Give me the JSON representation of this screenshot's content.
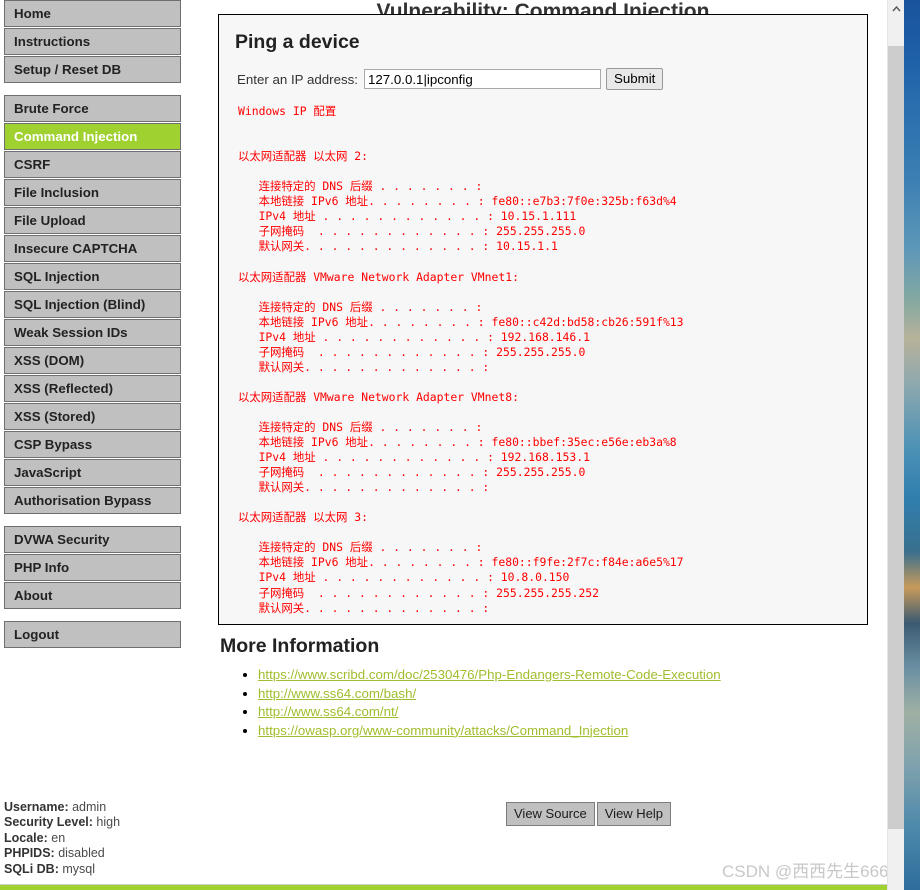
{
  "page": {
    "title": "Vulnerability: Command Injection",
    "bottom_rule_color": "#9fd130",
    "accent_color": "#9fd130"
  },
  "sidebar": {
    "groups": [
      {
        "name": "primary",
        "items": [
          {
            "label": "Home",
            "active": false
          },
          {
            "label": "Instructions",
            "active": false
          },
          {
            "label": "Setup / Reset DB",
            "active": false
          }
        ]
      },
      {
        "name": "vulnerabilities",
        "items": [
          {
            "label": "Brute Force",
            "active": false
          },
          {
            "label": "Command Injection",
            "active": true
          },
          {
            "label": "CSRF",
            "active": false
          },
          {
            "label": "File Inclusion",
            "active": false
          },
          {
            "label": "File Upload",
            "active": false
          },
          {
            "label": "Insecure CAPTCHA",
            "active": false
          },
          {
            "label": "SQL Injection",
            "active": false
          },
          {
            "label": "SQL Injection (Blind)",
            "active": false
          },
          {
            "label": "Weak Session IDs",
            "active": false
          },
          {
            "label": "XSS (DOM)",
            "active": false
          },
          {
            "label": "XSS (Reflected)",
            "active": false
          },
          {
            "label": "XSS (Stored)",
            "active": false
          },
          {
            "label": "CSP Bypass",
            "active": false
          },
          {
            "label": "JavaScript",
            "active": false
          },
          {
            "label": "Authorisation Bypass",
            "active": false
          }
        ]
      },
      {
        "name": "meta",
        "items": [
          {
            "label": "DVWA Security",
            "active": false
          },
          {
            "label": "PHP Info",
            "active": false
          },
          {
            "label": "About",
            "active": false
          }
        ]
      },
      {
        "name": "session",
        "items": [
          {
            "label": "Logout",
            "active": false
          }
        ]
      }
    ]
  },
  "main": {
    "heading": "Ping a device",
    "form": {
      "label": "Enter an IP address:",
      "input_value": "127.0.0.1|ipconfig",
      "input_placeholder": "",
      "submit_label": "Submit"
    },
    "command_output": "Windows IP 配置\n\n\n以太网适配器 以太网 2:\n\n   连接特定的 DNS 后缀 . . . . . . . :\n   本地链接 IPv6 地址. . . . . . . . : fe80::e7b3:7f0e:325b:f63d%4\n   IPv4 地址 . . . . . . . . . . . . : 10.15.1.111\n   子网掩码  . . . . . . . . . . . . : 255.255.255.0\n   默认网关. . . . . . . . . . . . . : 10.15.1.1\n\n以太网适配器 VMware Network Adapter VMnet1:\n\n   连接特定的 DNS 后缀 . . . . . . . :\n   本地链接 IPv6 地址. . . . . . . . : fe80::c42d:bd58:cb26:591f%13\n   IPv4 地址 . . . . . . . . . . . . : 192.168.146.1\n   子网掩码  . . . . . . . . . . . . : 255.255.255.0\n   默认网关. . . . . . . . . . . . . :\n\n以太网适配器 VMware Network Adapter VMnet8:\n\n   连接特定的 DNS 后缀 . . . . . . . :\n   本地链接 IPv6 地址. . . . . . . . : fe80::bbef:35ec:e56e:eb3a%8\n   IPv4 地址 . . . . . . . . . . . . : 192.168.153.1\n   子网掩码  . . . . . . . . . . . . : 255.255.255.0\n   默认网关. . . . . . . . . . . . . :\n\n以太网适配器 以太网 3:\n\n   连接特定的 DNS 后缀 . . . . . . . :\n   本地链接 IPv6 地址. . . . . . . . : fe80::f9fe:2f7c:f84e:a6e5%17\n   IPv4 地址 . . . . . . . . . . . . : 10.8.0.150\n   子网掩码  . . . . . . . . . . . . : 255.255.255.252\n   默认网关. . . . . . . . . . . . . :",
    "output_color": "#ff0000"
  },
  "more_information": {
    "heading": "More Information",
    "links": [
      "https://www.scribd.com/doc/2530476/Php-Endangers-Remote-Code-Execution",
      "http://www.ss64.com/bash/",
      "http://www.ss64.com/nt/",
      "https://owasp.org/www-community/attacks/Command_Injection"
    ]
  },
  "system_info": {
    "rows": [
      {
        "label": "Username:",
        "value": "admin"
      },
      {
        "label": "Security Level:",
        "value": "high"
      },
      {
        "label": "Locale:",
        "value": "en"
      },
      {
        "label": "PHPIDS:",
        "value": "disabled"
      },
      {
        "label": "SQLi DB:",
        "value": "mysql"
      }
    ]
  },
  "actions": {
    "view_source_label": "View Source",
    "view_help_label": "View Help"
  },
  "watermark": {
    "text": "CSDN @西西先生666"
  },
  "scrollbar": {
    "up_arrow_icon": "chevron-up-icon"
  }
}
